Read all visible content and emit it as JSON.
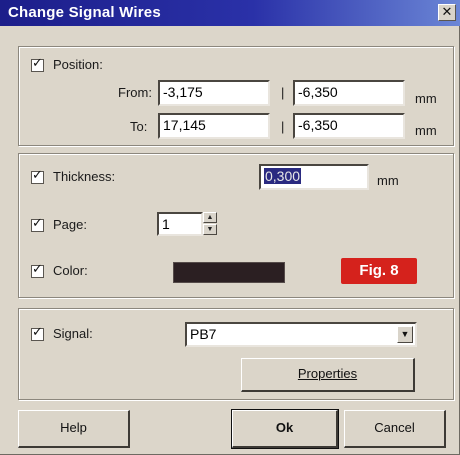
{
  "window": {
    "title": "Change Signal Wires",
    "close_glyph": "✕"
  },
  "position": {
    "label": "Position:",
    "from_label": "From:",
    "to_label": "To:",
    "from_x": "-3,175",
    "from_y": "-6,350",
    "to_x": "17,145",
    "to_y": "-6,350",
    "separator": "|",
    "unit": "mm"
  },
  "thickness": {
    "label": "Thickness:",
    "value": "0,300",
    "unit": "mm"
  },
  "page": {
    "label": "Page:",
    "value": "1"
  },
  "color": {
    "label": "Color:",
    "swatch": "#2b1f22"
  },
  "figure_badge": {
    "text": "Fig. 8",
    "color": "#d5221c"
  },
  "signal": {
    "label": "Signal:",
    "value": "PB7",
    "properties_button": "Properties"
  },
  "buttons": {
    "help": "Help",
    "ok": "Ok",
    "cancel": "Cancel"
  }
}
